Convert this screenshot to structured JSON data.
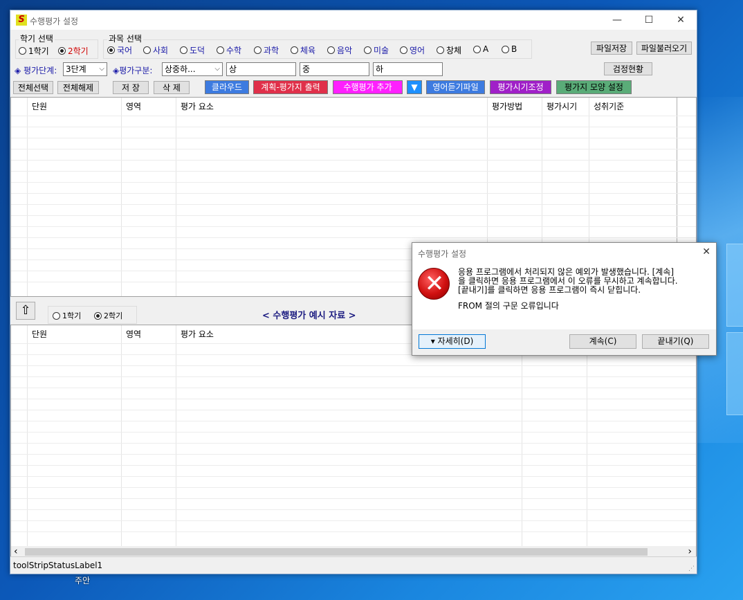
{
  "window": {
    "title": "수행평가 설정",
    "min_glyph": "—",
    "max_glyph": "☐",
    "close_glyph": "✕"
  },
  "semester_group": {
    "label": "학기 선택",
    "options": [
      "1학기",
      "2학기"
    ],
    "selected": "2학기"
  },
  "subject_group": {
    "label": "과목 선택",
    "options": [
      "국어",
      "사회",
      "도덕",
      "수학",
      "과학",
      "체육",
      "음악",
      "미술",
      "영어",
      "창체",
      "A",
      "B"
    ],
    "selected": "국어"
  },
  "file_buttons": {
    "save": "파일저장",
    "load": "파일불러오기"
  },
  "eval_row": {
    "level_label": "◈ 평가단계:",
    "level_value": "3단계",
    "type_label": "◈평가구분:",
    "type_value": "상중하...",
    "high": "상",
    "mid": "중",
    "low": "하",
    "check_button": "검정현황"
  },
  "action_buttons": {
    "select_all": "전체선택",
    "deselect_all": "전체해제",
    "save": "저 장",
    "delete": "삭 제",
    "cloud": "클라우드",
    "plan_print": "계획-평가지 출력",
    "add_eval": "수행평가 추가",
    "dropdown": "▼",
    "english_file": "영어듣기파일",
    "time_adjust": "평가시기조정",
    "shape_setting": "평가지 모양 설정"
  },
  "colors": {
    "cloud": "#3d7be0",
    "plan_print": "#e0304a",
    "add_eval": "#ff20ff",
    "dropdown": "#1e90ff",
    "english_file": "#3d7be0",
    "time_adjust": "#a020c8",
    "shape_setting": "#5aac78"
  },
  "top_grid": {
    "columns": [
      "단원",
      "영역",
      "평가 요소",
      "평가방법",
      "평가시기",
      "성취기준"
    ]
  },
  "example_bar": {
    "up_icon": "⇧",
    "options": [
      "1학기",
      "2학기"
    ],
    "selected": "2학기",
    "title": "< 수행평가 예시 자료 >"
  },
  "bottom_grid": {
    "columns": [
      "단원",
      "영역",
      "평가 요소"
    ]
  },
  "scroll": {
    "left": "‹",
    "right": "›"
  },
  "status": {
    "label": "toolStripStatusLabel1"
  },
  "desktop": {
    "label": "주안"
  },
  "dialog": {
    "title": "수행평가 설정",
    "close_glyph": "✕",
    "error_glyph": "✕",
    "message_lines": [
      "응용 프로그램에서 처리되지 않은 예외가 발생했습니다. [계속]",
      "을 클릭하면 응용 프로그램에서 이 오류를 무시하고 계속합니다.",
      "[끝내기]를 클릭하면 응용 프로그램이 즉시 닫힙니다."
    ],
    "detail_message": "FROM 절의 구문 오류입니다",
    "details_button": "▾ 자세히(D)",
    "continue_button": "계속(C)",
    "quit_button": "끝내기(Q)"
  }
}
